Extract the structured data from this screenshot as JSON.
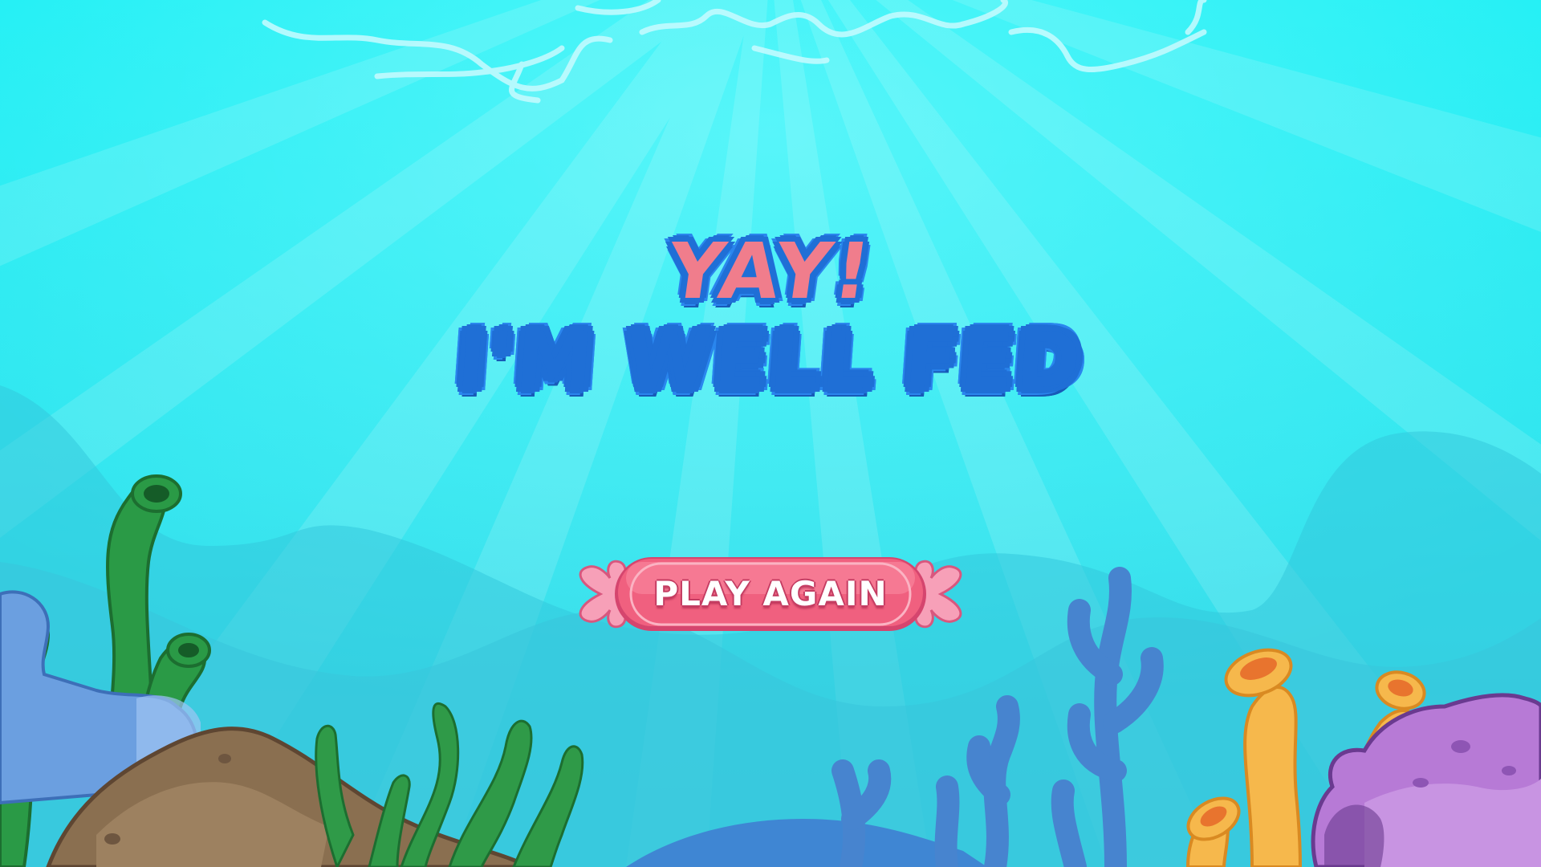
{
  "screen": {
    "title_line1": "YAY!",
    "title_line2": "I'M WELL FED"
  },
  "buttons": {
    "play_again_label": "PLAY AGAIN"
  },
  "colors": {
    "water_top": "#18f0f4",
    "water_bottom": "#39d6e6",
    "title_outline": "#1f6fd6",
    "title_pink": "#f07d8c",
    "title_yellow": "#ffe21a",
    "button_pink": "#f0607f",
    "seaweed_green": "#2a8a3e",
    "coral_blue": "#4a86d0",
    "coral_yellow": "#f6b84c",
    "coral_purple": "#b77ad6",
    "rock_brown": "#8a6b4a"
  },
  "icons": {
    "background": "underwater-scene",
    "button_decor": "shell-wings-icon"
  }
}
